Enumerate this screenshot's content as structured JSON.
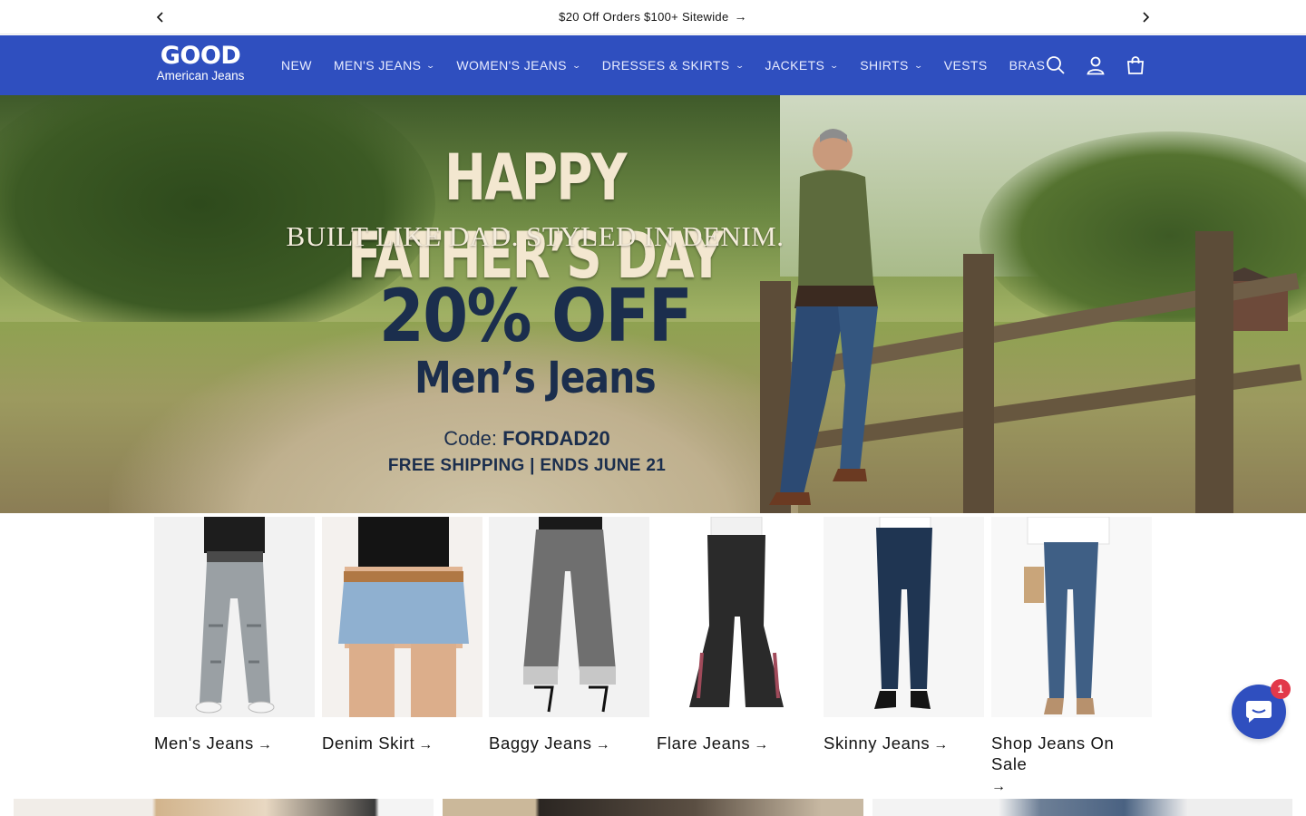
{
  "announcement": {
    "message": "$20 Off Orders $100+ Sitewide",
    "arrow": "→",
    "prev_icon": "chevron-left-icon",
    "next_icon": "chevron-right-icon"
  },
  "header": {
    "brand": "#2f4fbf",
    "logo_line1": "GOOD",
    "logo_line2": "American Jeans",
    "nav": [
      {
        "label": "NEW",
        "has_dropdown": false
      },
      {
        "label": "MEN'S JEANS",
        "has_dropdown": true
      },
      {
        "label": "WOMEN'S JEANS",
        "has_dropdown": true
      },
      {
        "label": "DRESSES & SKIRTS",
        "has_dropdown": true
      },
      {
        "label": "JACKETS",
        "has_dropdown": true
      },
      {
        "label": "SHIRTS",
        "has_dropdown": true
      },
      {
        "label": "VESTS",
        "has_dropdown": false
      },
      {
        "label": "BRAS",
        "has_dropdown": false
      }
    ],
    "icons": [
      "search-icon",
      "account-icon",
      "cart-icon"
    ]
  },
  "hero": {
    "line1": "HAPPY FATHER’S DAY",
    "line2": "BUILT LIKE DAD. STYLED IN DENIM.",
    "line3": "20% OFF",
    "line4": "Men’s Jeans",
    "code_label": "Code: ",
    "code_value": "FORDAD20",
    "shipping": "FREE SHIPPING  |  ENDS JUNE 21"
  },
  "collections": [
    {
      "title": "Men's Jeans",
      "arrow": "→"
    },
    {
      "title": "Denim Skirt",
      "arrow": "→"
    },
    {
      "title": "Baggy Jeans",
      "arrow": "→"
    },
    {
      "title": "Flare Jeans",
      "arrow": "→"
    },
    {
      "title": "Skinny Jeans",
      "arrow": "→"
    },
    {
      "title": "Shop Jeans On Sale",
      "arrow": "→"
    }
  ],
  "chat": {
    "badge_count": "1",
    "icon": "chat-icon"
  }
}
